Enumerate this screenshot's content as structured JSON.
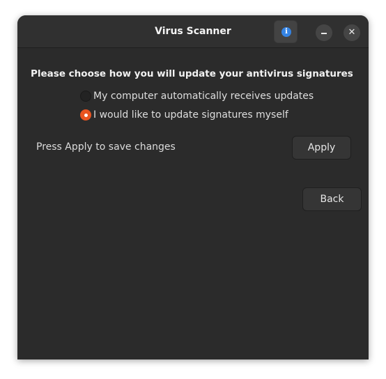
{
  "window": {
    "title": "Virus Scanner",
    "close_glyph": "✕"
  },
  "content": {
    "heading": "Please choose how you will update your antivirus signatures",
    "options": [
      {
        "label": "My computer automatically receives updates",
        "selected": false
      },
      {
        "label": "I would like to update signatures myself",
        "selected": true
      }
    ],
    "hint": "Press Apply to save changes",
    "apply_label": "Apply",
    "back_label": "Back"
  },
  "colors": {
    "accent": "#e95420",
    "info": "#3584e4",
    "background": "#2b2b2b"
  },
  "icons": {
    "info": "info-icon",
    "minimize": "minimize-icon",
    "close": "close-icon"
  }
}
